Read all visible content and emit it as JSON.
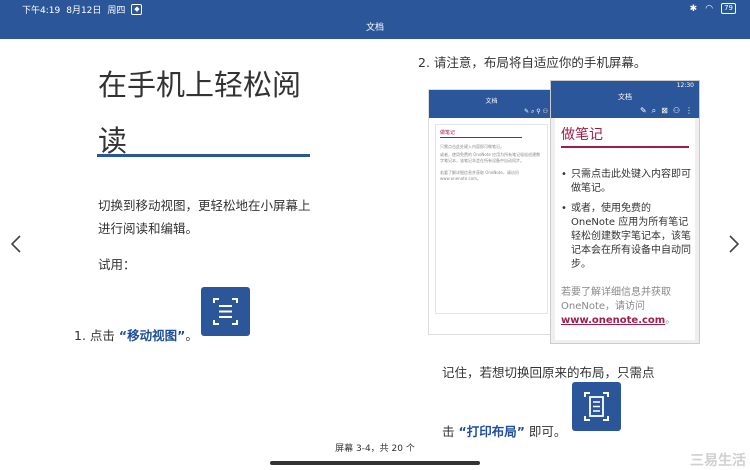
{
  "status_bar": {
    "time": "下午4:19",
    "date": "8月12日",
    "weekday": "周四",
    "battery": "79"
  },
  "app_bar": {
    "title": "文档"
  },
  "left_page": {
    "title": "在手机上轻松阅读",
    "intro": "切换到移动视图，更轻松地在小屏幕上进行阅读和编辑。",
    "try_label": "试用：",
    "step1_prefix": "1. 点击",
    "step1_link": "“移动视图”",
    "step1_suffix": "。"
  },
  "right_page": {
    "step2": "2. 请注意，布局将自适应你的手机屏幕。",
    "phone_back": {
      "title": "文档",
      "heading": "做笔记",
      "line1": "只需点击此处键入内容即可做笔记。",
      "line2": "或者，使用免费的 OneNote 应用为所有笔记轻松创建数字笔记本，该笔记本会在所有设备中自动同步。",
      "line3": "若要了解详细信息并获取 OneNote，请访问 www.onenote.com。"
    },
    "phone_front": {
      "time": "12:30",
      "title": "文档",
      "heading": "做笔记",
      "bullets": [
        "只需点击此处键入内容即可做笔记。",
        "或者，使用免费的 OneNote 应用为所有笔记轻松创建数字笔记本，该笔记本会在所有设备中自动同步。"
      ],
      "more": "若要了解详细信息并获取 OneNote，请访问",
      "link": "www.onenote.com",
      "link_suffix": "。"
    },
    "remember": "记住，若想切换回原来的布局，只需点",
    "step_print_prefix": "击",
    "step_print_link": "“打印布局”",
    "step_print_suffix": "即可。"
  },
  "footer": {
    "page_indicator": "屏幕 3-4，共 20 个"
  },
  "watermark": "三易生活",
  "icons": {
    "left_arrow": "chevron-left-icon",
    "right_arrow": "chevron-right-icon",
    "mobile_view": "mobile-view-icon",
    "print_layout": "print-layout-icon"
  },
  "colors": {
    "accent": "#2b579a",
    "heading": "#a01d4a"
  }
}
